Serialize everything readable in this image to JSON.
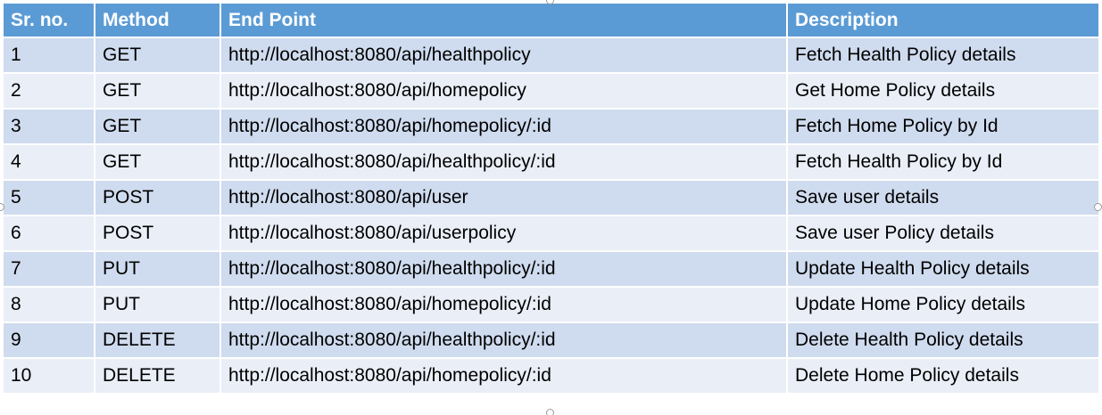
{
  "table": {
    "headers": [
      "Sr. no.",
      "Method",
      "End Point",
      "Description"
    ],
    "rows": [
      [
        "1",
        "GET",
        "http://localhost:8080/api/healthpolicy",
        "Fetch Health Policy details"
      ],
      [
        "2",
        "GET",
        "http://localhost:8080/api/homepolicy",
        "Get Home Policy details"
      ],
      [
        "3",
        "GET",
        "http://localhost:8080/api/homepolicy/:id",
        "Fetch Home Policy by Id"
      ],
      [
        "4",
        "GET",
        "http://localhost:8080/api/healthpolicy/:id",
        "Fetch Health Policy by Id"
      ],
      [
        "5",
        "POST",
        "http://localhost:8080/api/user",
        "Save user details"
      ],
      [
        "6",
        "POST",
        "http://localhost:8080/api/userpolicy",
        "Save user Policy details"
      ],
      [
        "7",
        "PUT",
        "http://localhost:8080/api/healthpolicy/:id",
        "Update Health Policy details"
      ],
      [
        "8",
        "PUT",
        "http://localhost:8080/api/homepolicy/:id",
        "Update Home Policy details"
      ],
      [
        "9",
        "DELETE",
        "http://localhost:8080/api/healthpolicy/:id",
        "Delete Health Policy details"
      ],
      [
        "10",
        "DELETE",
        "http://localhost:8080/api/homepolicy/:id",
        "Delete Home Policy details"
      ]
    ]
  },
  "colors": {
    "header_bg": "#5b9bd5",
    "row_odd_bg": "#cfdbee",
    "row_even_bg": "#e9eef7"
  }
}
